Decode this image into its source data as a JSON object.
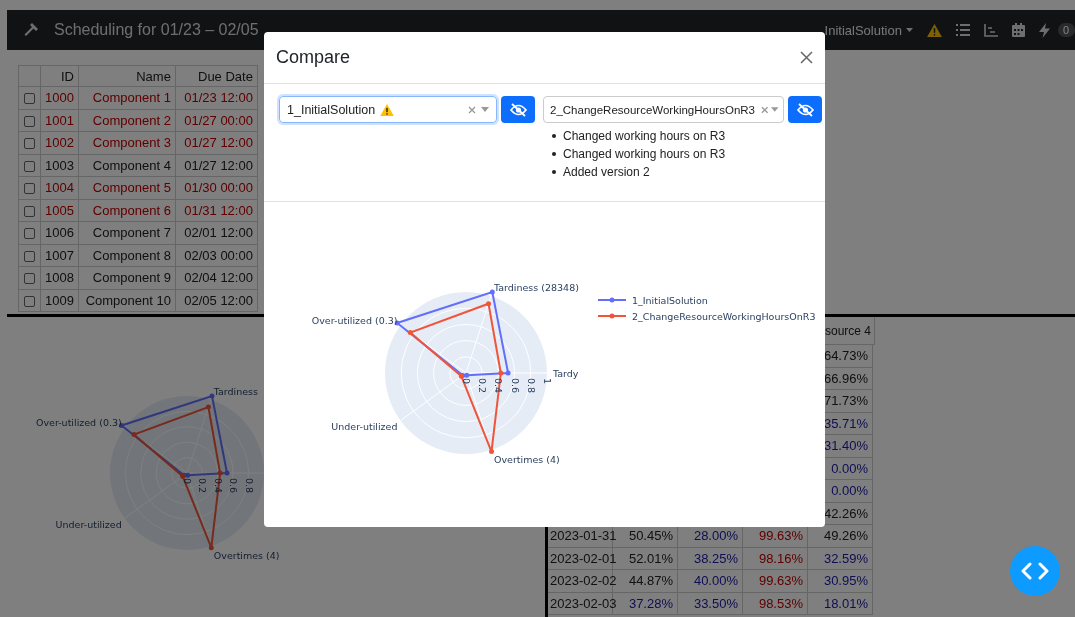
{
  "header": {
    "title": "Scheduling for 01/23 – 02/05",
    "solution": "InitialSolution",
    "warning": true,
    "badge": "0"
  },
  "jobs": {
    "columns": [
      "ID",
      "Name",
      "Due Date"
    ],
    "rows": [
      {
        "id": "1000",
        "name": "Component 1",
        "due": "01/23 12:00",
        "late": true,
        "checked": false
      },
      {
        "id": "1001",
        "name": "Component 2",
        "due": "01/27 00:00",
        "late": true,
        "checked": false
      },
      {
        "id": "1002",
        "name": "Component 3",
        "due": "01/27 12:00",
        "late": true,
        "checked": false
      },
      {
        "id": "1003",
        "name": "Component 4",
        "due": "01/27 12:00",
        "late": false,
        "checked": false
      },
      {
        "id": "1004",
        "name": "Component 5",
        "due": "01/30 00:00",
        "late": true,
        "checked": false
      },
      {
        "id": "1005",
        "name": "Component 6",
        "due": "01/31 12:00",
        "late": true,
        "checked": false
      },
      {
        "id": "1006",
        "name": "Component 7",
        "due": "02/01 12:00",
        "late": false,
        "checked": false
      },
      {
        "id": "1007",
        "name": "Component 8",
        "due": "02/03 00:00",
        "late": false,
        "checked": false
      },
      {
        "id": "1008",
        "name": "Component 9",
        "due": "02/04 12:00",
        "late": false,
        "checked": false
      },
      {
        "id": "1009",
        "name": "Component 10",
        "due": "02/05 12:00",
        "late": false,
        "checked": false
      }
    ]
  },
  "background_chart": {
    "labels": [
      {
        "text": "Tardiness",
        "kind": "top"
      },
      {
        "text": "Over-utilized (0.3)",
        "kind": "upperleft"
      },
      {
        "text": "Under-utilized",
        "kind": "lowerleft"
      },
      {
        "text": "Overtimes (4)",
        "kind": "bottom"
      }
    ],
    "ticks": [
      "0",
      "0.2",
      "0.4",
      "0.6",
      "0.8"
    ]
  },
  "utilization": {
    "columns": [
      "source 4"
    ],
    "rows": [
      {
        "cells": [
          {
            "text": "64.73%",
            "kind": "normal"
          }
        ]
      },
      {
        "cells": [
          {
            "text": "66.96%",
            "kind": "normal"
          }
        ]
      },
      {
        "cells": [
          {
            "text": "71.73%",
            "kind": "normal"
          }
        ]
      },
      {
        "cells": [
          {
            "text": "35.71%",
            "kind": "under"
          }
        ]
      },
      {
        "cells": [
          {
            "text": "31.40%",
            "kind": "under"
          }
        ]
      },
      {
        "cells": [
          {
            "text": "0.00%",
            "kind": "under"
          }
        ]
      },
      {
        "cells": [
          {
            "text": "0.00%",
            "kind": "under"
          }
        ]
      },
      {
        "cells": [
          {
            "text": "42.26%",
            "kind": "normal"
          }
        ]
      },
      {
        "date": "2023-01-31",
        "cells": [
          {
            "text": "50.45%",
            "kind": "normal"
          },
          {
            "text": "28.00%",
            "kind": "under"
          },
          {
            "text": "99.63%",
            "kind": "over"
          },
          {
            "text": "49.26%",
            "kind": "normal"
          }
        ]
      },
      {
        "date": "2023-02-01",
        "cells": [
          {
            "text": "52.01%",
            "kind": "normal"
          },
          {
            "text": "38.25%",
            "kind": "under"
          },
          {
            "text": "98.16%",
            "kind": "over"
          },
          {
            "text": "32.59%",
            "kind": "under"
          }
        ]
      },
      {
        "date": "2023-02-02",
        "cells": [
          {
            "text": "44.87%",
            "kind": "normal"
          },
          {
            "text": "40.00%",
            "kind": "under"
          },
          {
            "text": "99.63%",
            "kind": "over"
          },
          {
            "text": "30.95%",
            "kind": "under"
          }
        ]
      },
      {
        "date": "2023-02-03",
        "cells": [
          {
            "text": "37.28%",
            "kind": "under"
          },
          {
            "text": "33.50%",
            "kind": "under"
          },
          {
            "text": "98.53%",
            "kind": "over"
          },
          {
            "text": "18.01%",
            "kind": "under"
          }
        ]
      }
    ]
  },
  "modal": {
    "title": "Compare",
    "selectors": [
      {
        "value": "1_InitialSolution",
        "warning": true,
        "focused": true
      },
      {
        "value": "2_ChangeResourceWorkingHoursOnR3",
        "warning": false,
        "focused": false,
        "notes": [
          "Changed working hours on R3",
          "Changed working hours on R3",
          "Added version 2"
        ]
      }
    ],
    "chart": {
      "labels": [
        {
          "text": "Tardiness (28348)",
          "kind": "top"
        },
        {
          "text": "Over-utilized (0.3)",
          "kind": "upperleft"
        },
        {
          "text": "Tardy",
          "kind": "right"
        },
        {
          "text": "Under-utilized",
          "kind": "lowerleft"
        },
        {
          "text": "Overtimes (4)",
          "kind": "bottom"
        }
      ],
      "ticks": [
        "0",
        "0.2",
        "0.4",
        "0.6",
        "0.8",
        "1"
      ],
      "legend": [
        {
          "name": "1_InitialSolution",
          "color": "#636efa"
        },
        {
          "name": "2_ChangeResourceWorkingHoursOnR3",
          "color": "#ef553b"
        }
      ]
    }
  }
}
